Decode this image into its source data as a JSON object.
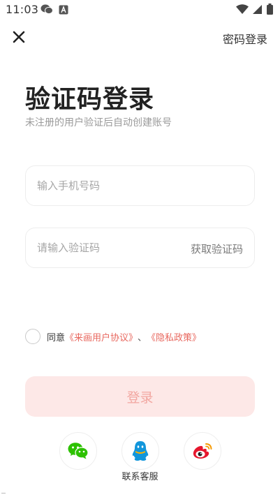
{
  "status_bar": {
    "time": "11:03",
    "left_icons": [
      "wechat-status-icon",
      "store-status-icon"
    ],
    "right_icons": [
      "wifi-icon",
      "signal-icon",
      "battery-icon"
    ]
  },
  "header": {
    "close_icon": "close-icon",
    "password_login": "密码登录"
  },
  "main": {
    "title": "验证码登录",
    "subtitle": "未注册的用户验证后自动创建账号"
  },
  "form": {
    "phone_placeholder": "输入手机号码",
    "phone_value": "",
    "code_placeholder": "请输入验证码",
    "code_value": "",
    "get_code": "获取验证码"
  },
  "agreement": {
    "checked": false,
    "prefix": "同意",
    "user_agreement": "《来画用户协议》",
    "separator": "、",
    "privacy_policy": "《隐私政策》"
  },
  "login_button": "登录",
  "social": {
    "icons": [
      "wechat-icon",
      "qq-icon",
      "weibo-icon"
    ],
    "label": "联系客服"
  },
  "colors": {
    "accent": "#e8675e",
    "login_bg": "#fde8e7",
    "login_text": "#f2a6a0",
    "wechat": "#2dc100",
    "qq": "#1296db",
    "weibo": "#e6162d"
  }
}
